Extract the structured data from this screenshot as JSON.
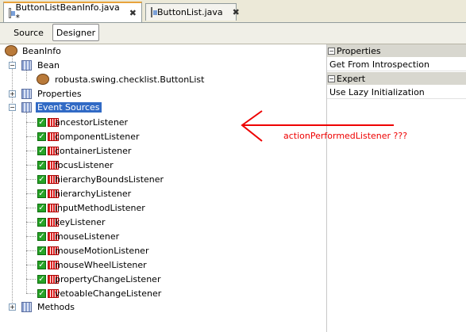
{
  "tabs": [
    {
      "label": "ButtonListBeanInfo.java *",
      "active": true
    },
    {
      "label": "ButtonList.java",
      "active": false
    }
  ],
  "close_glyph": "✖",
  "view_buttons": {
    "source": "Source",
    "designer": "Designer"
  },
  "tree": {
    "root": "BeanInfo",
    "bean": "Bean",
    "bean_class": "robusta.swing.checklist.ButtonList",
    "properties": "Properties",
    "event_sources": "Event Sources",
    "listeners": [
      "ancestorListener",
      "componentListener",
      "containerListener",
      "focusListener",
      "hierarchyBoundsListener",
      "hierarchyListener",
      "inputMethodListener",
      "keyListener",
      "mouseListener",
      "mouseMotionListener",
      "mouseWheelListener",
      "propertyChangeListener",
      "vetoableChangeListener"
    ],
    "methods": "Methods"
  },
  "property_sheet": {
    "groups": [
      {
        "header": "Properties",
        "rows": [
          "Get From Introspection"
        ]
      },
      {
        "header": "Expert",
        "rows": [
          "Use Lazy Initialization"
        ]
      }
    ]
  },
  "annotation": {
    "text": "actionPerformedListener ???",
    "color": "#e00000"
  },
  "colors": {
    "selection": "#316ac5",
    "active_tab_accent": "#e8a33c",
    "checkbox": "#27a327"
  }
}
